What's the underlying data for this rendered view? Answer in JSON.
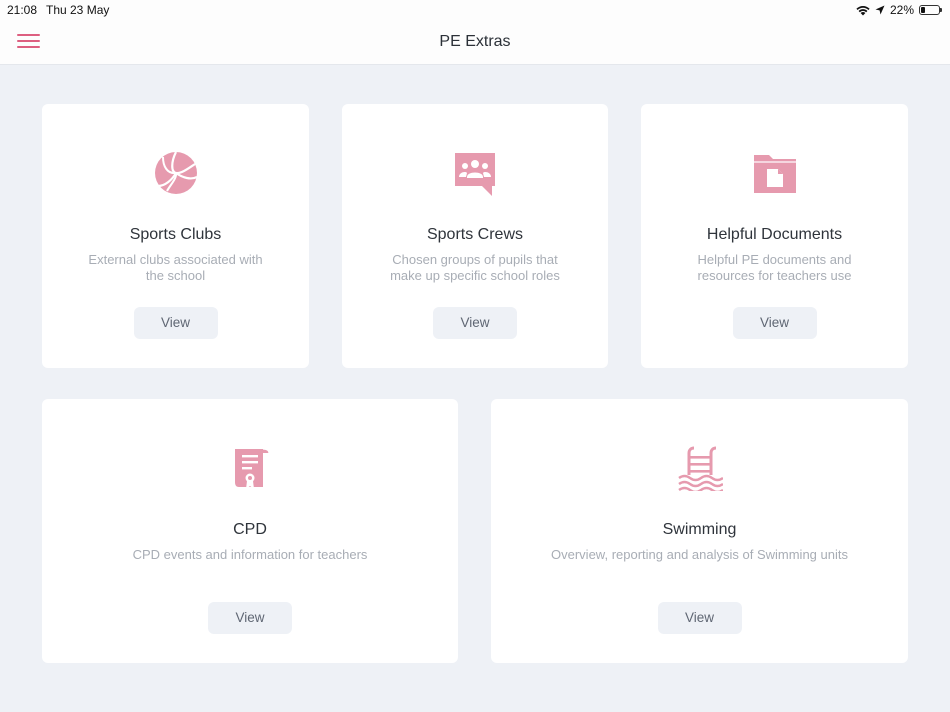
{
  "status": {
    "time": "21:08",
    "date": "Thu 23 May",
    "battery": "22%",
    "battery_level": 0.22
  },
  "nav": {
    "title": "PE Extras",
    "menu_icon": "hamburger-menu-icon"
  },
  "colors": {
    "accent": "#dd5f80",
    "icon": "#e69aae",
    "background": "#eef1f6",
    "card": "#ffffff"
  },
  "cards": [
    {
      "title": "Sports Clubs",
      "description": "External clubs associated with the school",
      "button": "View",
      "icon": "volleyball-icon"
    },
    {
      "title": "Sports Crews",
      "description": "Chosen groups of pupils that make up specific school roles",
      "button": "View",
      "icon": "group-chat-icon"
    },
    {
      "title": "Helpful Documents",
      "description": "Helpful PE documents and resources for teachers use",
      "button": "View",
      "icon": "folder-document-icon"
    },
    {
      "title": "CPD",
      "description": "CPD events and information for teachers",
      "button": "View",
      "icon": "certificate-icon"
    },
    {
      "title": "Swimming",
      "description": "Overview, reporting and analysis of Swimming units",
      "button": "View",
      "icon": "swimming-pool-icon"
    }
  ]
}
